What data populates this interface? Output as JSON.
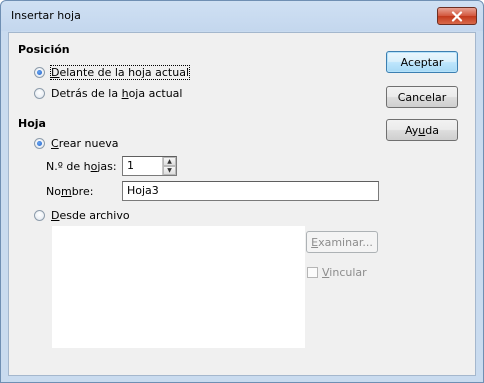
{
  "window": {
    "title": "Insertar hoja"
  },
  "position": {
    "heading": "Posición",
    "before": {
      "pre": "",
      "mnemonic": "D",
      "post": "elante de la hoja actual",
      "checked": true
    },
    "after": {
      "pre": "Detrás de la ",
      "mnemonic": "h",
      "post": "oja actual",
      "checked": false
    }
  },
  "sheet": {
    "heading": "Hoja",
    "new": {
      "pre": "",
      "mnemonic": "C",
      "post": "rear nueva",
      "checked": true
    },
    "count_label": {
      "pre": "N.º de h",
      "mnemonic": "o",
      "post": "jas:"
    },
    "count_value": "1",
    "name_label": {
      "pre": "No",
      "mnemonic": "m",
      "post": "bre:"
    },
    "name_value": "Hoja3",
    "from_file": {
      "pre": "",
      "mnemonic": "D",
      "post": "esde archivo",
      "checked": false
    },
    "browse": {
      "pre": "",
      "mnemonic": "E",
      "post": "xaminar..."
    },
    "link": {
      "pre": "",
      "mnemonic": "V",
      "post": "incular"
    }
  },
  "buttons": {
    "ok": "Aceptar",
    "cancel": "Cancelar",
    "help": {
      "pre": "Ay",
      "mnemonic": "u",
      "post": "da"
    }
  },
  "colors": {
    "title_bar": "#c4d7ee",
    "close_button": "#c2391c",
    "dialog_bg": "#f0f0f0",
    "default_button": "#bee6fd"
  }
}
